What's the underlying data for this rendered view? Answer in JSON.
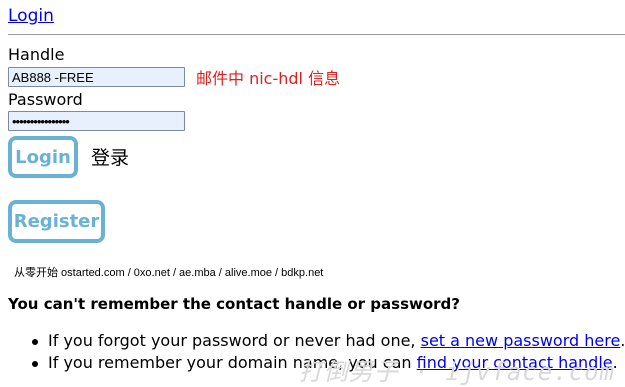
{
  "header": {
    "title_link": "Login"
  },
  "form": {
    "handle_label": "Handle",
    "handle_value": "AB888 -FREE",
    "handle_annotation": "邮件中 nic-hdl 信息",
    "password_label": "Password",
    "password_value": "••••••••••••••••",
    "login_button": "Login",
    "login_cn": "登录",
    "register_button": "Register"
  },
  "footer_links": "从零开始 ostarted.com / 0xo.net / ae.mba / alive.moe / bdkp.net",
  "help": {
    "heading": "You can't remember the contact handle or password?",
    "items": [
      {
        "text": "If you forgot your password or never had one, ",
        "link": "set a new password here",
        "suffix": "."
      },
      {
        "text": "If you remember your domain name, you can ",
        "link": "find your contact handle",
        "suffix": "."
      }
    ]
  },
  "watermark": "打倒男子 · ijvface.com",
  "colors": {
    "accent": "#6ab2d4",
    "annotation": "#e0201e",
    "link": "#0000ee"
  }
}
